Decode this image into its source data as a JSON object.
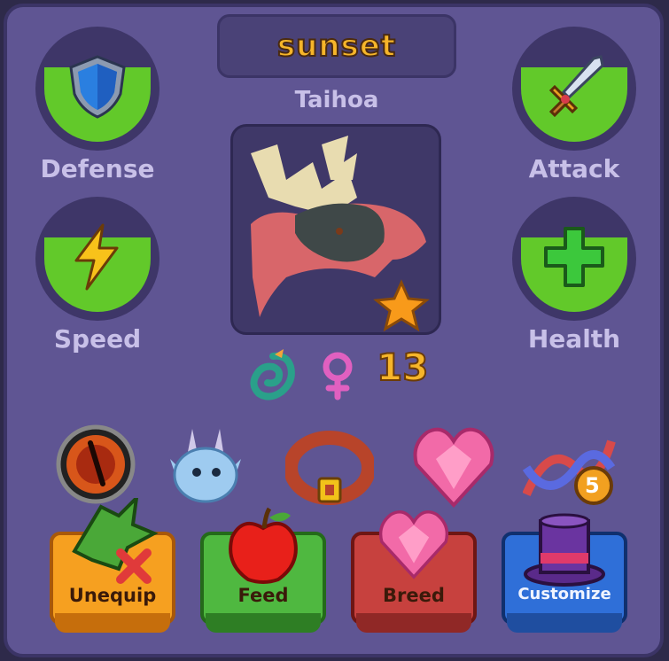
{
  "dragon": {
    "name": "sunset",
    "species": "Taihoa",
    "level": "13",
    "gender_icon": "female-icon",
    "element_icon": "water-dragon-icon"
  },
  "stats": {
    "defense": {
      "label": "Defense",
      "icon": "shield-icon",
      "fill": 0.6,
      "color": "#62c92a"
    },
    "attack": {
      "label": "Attack",
      "icon": "sword-icon",
      "fill": 0.6,
      "color": "#62c92a"
    },
    "speed": {
      "label": "Speed",
      "icon": "lightning-icon",
      "fill": 0.6,
      "color": "#62c92a"
    },
    "health": {
      "label": "Health",
      "icon": "plus-icon",
      "fill": 0.6,
      "color": "#62c92a"
    }
  },
  "items": [
    "eye-orb-icon",
    "blue-dragon-face-icon",
    "collar-icon",
    "pink-heart-gem-icon",
    "dna-icon"
  ],
  "dna_badge": "5",
  "buttons": {
    "unequip": {
      "label": "Unequip",
      "color": "#f6a020"
    },
    "feed": {
      "label": "Feed",
      "color": "#4fb840"
    },
    "breed": {
      "label": "Breed",
      "color": "#c7413e"
    },
    "customize": {
      "label": "Customize",
      "color": "#2f6fd8"
    }
  }
}
